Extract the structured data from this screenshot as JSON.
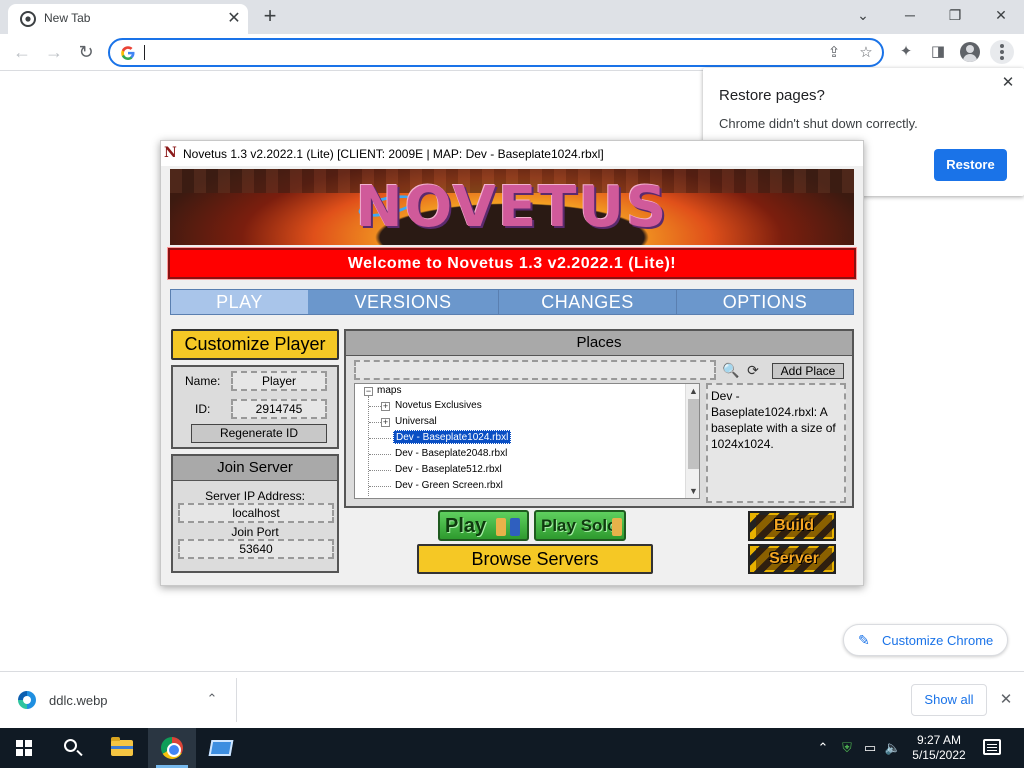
{
  "browser": {
    "tab": {
      "title": "New Tab",
      "close_glyph": "✕"
    },
    "newtab_glyph": "+",
    "window_controls": {
      "minimize": "─",
      "restore": "❐",
      "close": "✕",
      "tabsearch": "⌄"
    },
    "toolbar": {
      "back": "←",
      "forward": "→",
      "reload": "↻",
      "share": "⇪",
      "star": "☆",
      "extensions": "✦",
      "sidepanel": "◨"
    },
    "omnibox": {
      "value": ""
    },
    "restore_popup": {
      "title": "Restore pages?",
      "message": "Chrome didn't shut down correctly.",
      "button": "Restore",
      "close": "✕"
    },
    "customize_chrome": {
      "label": "Customize Chrome",
      "icon": "pencil-icon",
      "glyph": "✎"
    },
    "download_shelf": {
      "file": "ddlc.webp",
      "chevron": "⌃",
      "show_all": "Show all",
      "close": "✕"
    }
  },
  "novetus": {
    "title": "Novetus 1.3 v2.2022.1 (Lite) [CLIENT: 2009E | MAP: Dev - Baseplate1024.rbxl]",
    "logo": "N",
    "banner_text": "NOVETUS",
    "welcome": "Welcome to Novetus 1.3 v2.2022.1 (Lite)!",
    "tabs": [
      "PLAY",
      "VERSIONS",
      "CHANGES",
      "OPTIONS"
    ],
    "active_tab": "PLAY",
    "customize_player": "Customize Player",
    "name_label": "Name:",
    "name_value": "Player",
    "id_label": "ID:",
    "id_value": "2914745",
    "regenerate": "Regenerate ID",
    "join_server": "Join Server",
    "ip_label": "Server IP Address:",
    "ip_value": "localhost",
    "port_label": "Join Port",
    "port_value": "53640",
    "places": {
      "header": "Places",
      "search_value": "",
      "add_place": "Add Place",
      "search_glyph": "🔍",
      "refresh_glyph": "⟳",
      "tree": {
        "root": "maps",
        "folders": [
          "Novetus Exclusives",
          "Universal"
        ],
        "items": [
          "Dev - Baseplate1024.rbxl",
          "Dev - Baseplate2048.rbxl",
          "Dev - Baseplate512.rbxl",
          "Dev - Green Screen.rbxl"
        ],
        "selected": "Dev - Baseplate1024.rbxl"
      },
      "description": "Dev - Baseplate1024.rbxl: A baseplate with a size of 1024x1024."
    },
    "play_button": "Play",
    "play_solo_button": "Play Solo",
    "browse_servers": "Browse Servers",
    "build_button": "Build",
    "server_button": "Server"
  },
  "taskbar": {
    "clock_time": "9:27 AM",
    "clock_date": "5/15/2022",
    "tray": {
      "chevron": "⌃",
      "shield": "⛨",
      "network": "▭",
      "volume": "🔈"
    }
  }
}
